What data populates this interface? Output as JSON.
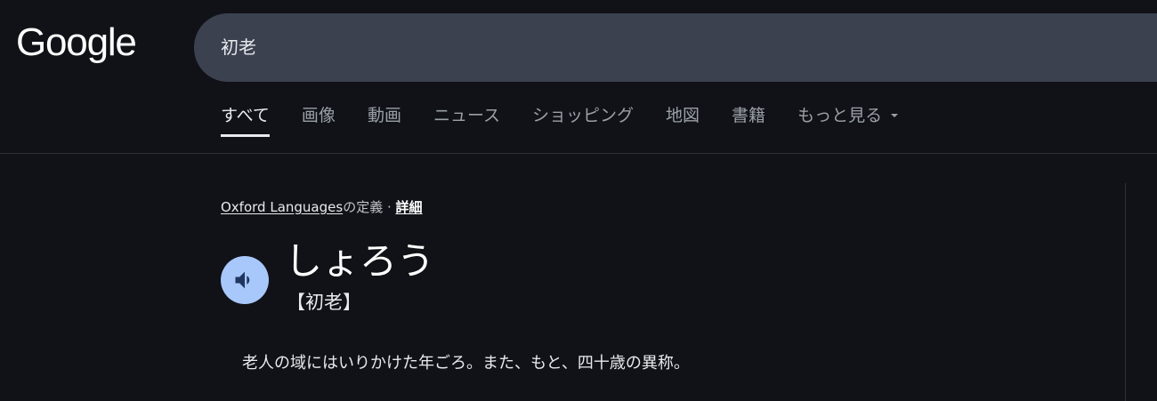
{
  "header": {
    "logo_text": "Google",
    "search": {
      "value": "初老"
    }
  },
  "tabs": [
    {
      "label": "すべて",
      "active": true
    },
    {
      "label": "画像",
      "active": false
    },
    {
      "label": "動画",
      "active": false
    },
    {
      "label": "ニュース",
      "active": false
    },
    {
      "label": "ショッピング",
      "active": false
    },
    {
      "label": "地図",
      "active": false
    },
    {
      "label": "書籍",
      "active": false
    },
    {
      "label": "もっと見る",
      "active": false,
      "has_caret": true
    }
  ],
  "dictionary": {
    "source_link": "Oxford Languages",
    "source_suffix": "の定義 · ",
    "detail_link": "詳細",
    "pronounce_icon": "speaker-icon",
    "reading": "しょろう",
    "kanji": "【初老】",
    "definition": "老人の域にはいりかけた年ごろ。また、もと、四十歳の異称。"
  },
  "colors": {
    "background": "#101218",
    "search_box": "#3c4150",
    "speaker_button": "#a8c7fa",
    "speaker_glyph": "#1f3760"
  }
}
